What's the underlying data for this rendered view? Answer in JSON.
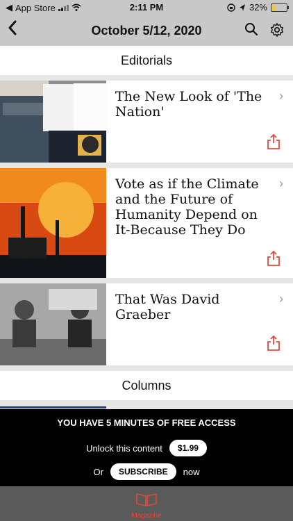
{
  "status_bar": {
    "carrier": "App Store",
    "time": "2:11 PM",
    "battery": "32%",
    "battery_level": 0.32
  },
  "header": {
    "title": "October 5/12, 2020"
  },
  "sections": [
    {
      "title": "Editorials"
    },
    {
      "title": "Columns"
    }
  ],
  "articles": [
    {
      "title": "The New Look of 'The Nation'"
    },
    {
      "title": "Vote as if the Climate and the Future of Humanity Depend on It-Because They Do"
    },
    {
      "title": "That Was David Graeber"
    }
  ],
  "paywall": {
    "message": "YOU HAVE 5 MINUTES OF FREE ACCESS",
    "unlock_text": "Unlock this content",
    "price": "$1.99",
    "or_text": "Or",
    "subscribe": "SUBSCRIBE",
    "now_text": "now"
  },
  "tabbar": {
    "magazine": "Magazine"
  },
  "colors": {
    "accent": "#e0493b"
  }
}
